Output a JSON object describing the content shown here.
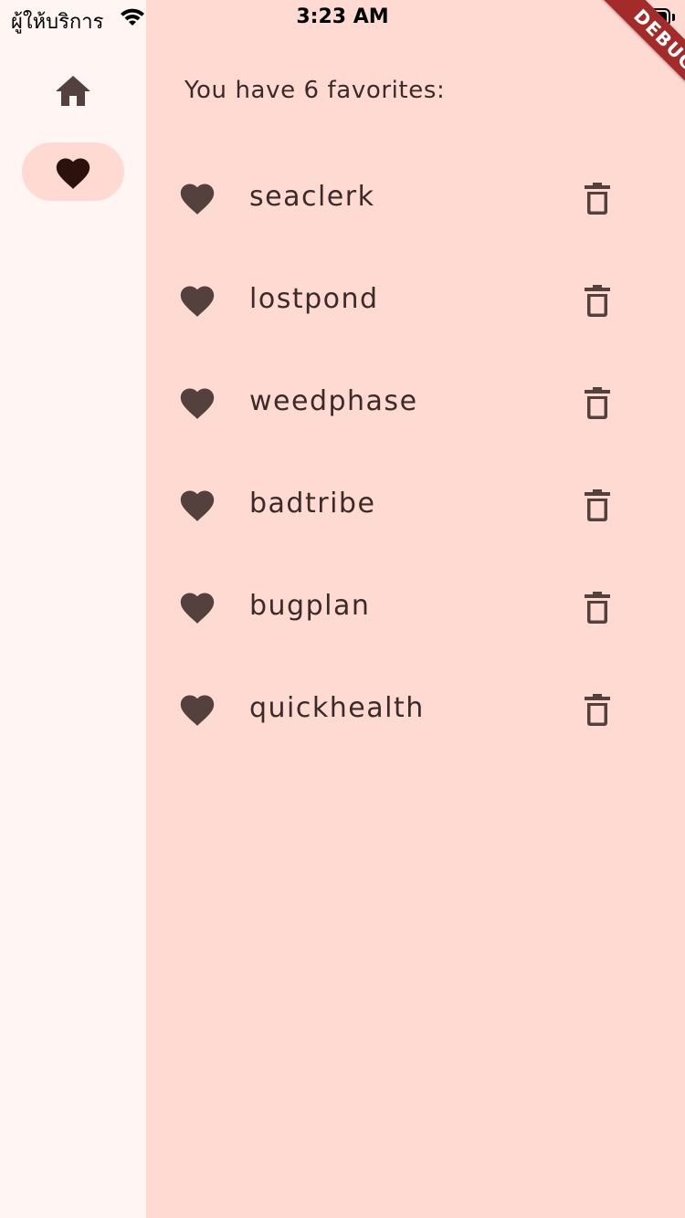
{
  "status_bar": {
    "carrier": "ผู้ให้บริการ",
    "time": "3:23 AM",
    "wifi_icon": "wifi-icon",
    "battery_icon": "battery-full-icon"
  },
  "debug_banner": {
    "label": "DEBUG"
  },
  "nav_rail": {
    "destinations": [
      {
        "icon": "home-icon",
        "selected": false
      },
      {
        "icon": "heart-icon",
        "selected": true
      }
    ]
  },
  "favorites": {
    "header": "You have 6 favorites:",
    "items": [
      {
        "name": "seaclerk",
        "icon": "heart-icon",
        "action_icon": "trash-icon"
      },
      {
        "name": "lostpond",
        "icon": "heart-icon",
        "action_icon": "trash-icon"
      },
      {
        "name": "weedphase",
        "icon": "heart-icon",
        "action_icon": "trash-icon"
      },
      {
        "name": "badtribe",
        "icon": "heart-icon",
        "action_icon": "trash-icon"
      },
      {
        "name": "bugplan",
        "icon": "heart-icon",
        "action_icon": "trash-icon"
      },
      {
        "name": "quickhealth",
        "icon": "heart-icon",
        "action_icon": "trash-icon"
      }
    ]
  },
  "colors": {
    "rail_background": "#fff5f3",
    "content_background": "#ffdad3",
    "selected_indicator": "#ffdad3",
    "icon": "#54403d",
    "selected_icon": "#2c120d",
    "text": "#3b2a27",
    "debug_ribbon": "#a32c2a"
  }
}
